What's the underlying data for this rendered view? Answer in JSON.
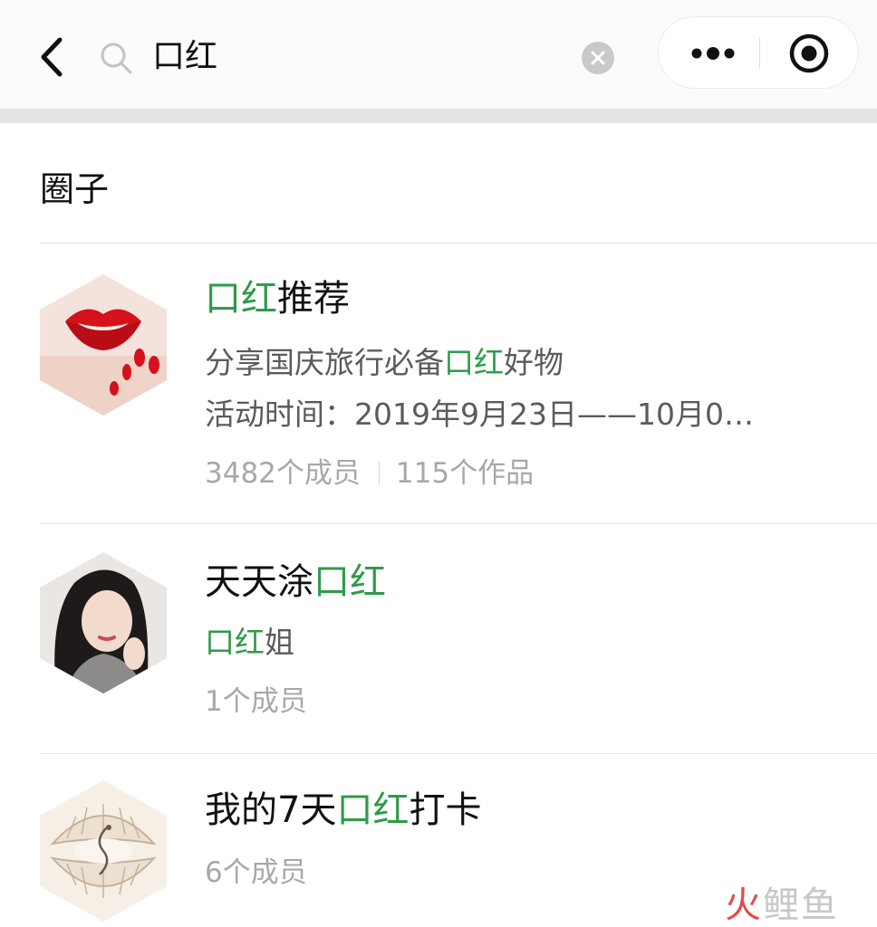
{
  "header": {
    "search_query": "口红",
    "icons": {
      "back": "chevron-left-icon",
      "search": "search-icon",
      "clear": "clear-icon",
      "more": "more-dots-icon",
      "close": "target-circle-icon"
    }
  },
  "section": {
    "title": "圈子"
  },
  "results": [
    {
      "title_parts": [
        "口红",
        "推荐"
      ],
      "desc_parts": [
        "分享国庆旅行必备",
        "口红",
        "好物"
      ],
      "activity": "活动时间：2019年9月23日——10月0…",
      "members": "3482个成员",
      "works": "115个作品"
    },
    {
      "title_parts": [
        "天天涂",
        "口红"
      ],
      "desc_parts": [
        "口红",
        "姐"
      ],
      "members": "1个成员"
    },
    {
      "title_parts": [
        "我的7天",
        "口红",
        "打卡"
      ],
      "members": "6个成员"
    }
  ],
  "watermark": {
    "part1": "火",
    "part2": "鲤鱼"
  },
  "colors": {
    "highlight": "#2f9b4a",
    "watermark_red": "#e8474a",
    "meta_gray": "#a8a8a8"
  }
}
